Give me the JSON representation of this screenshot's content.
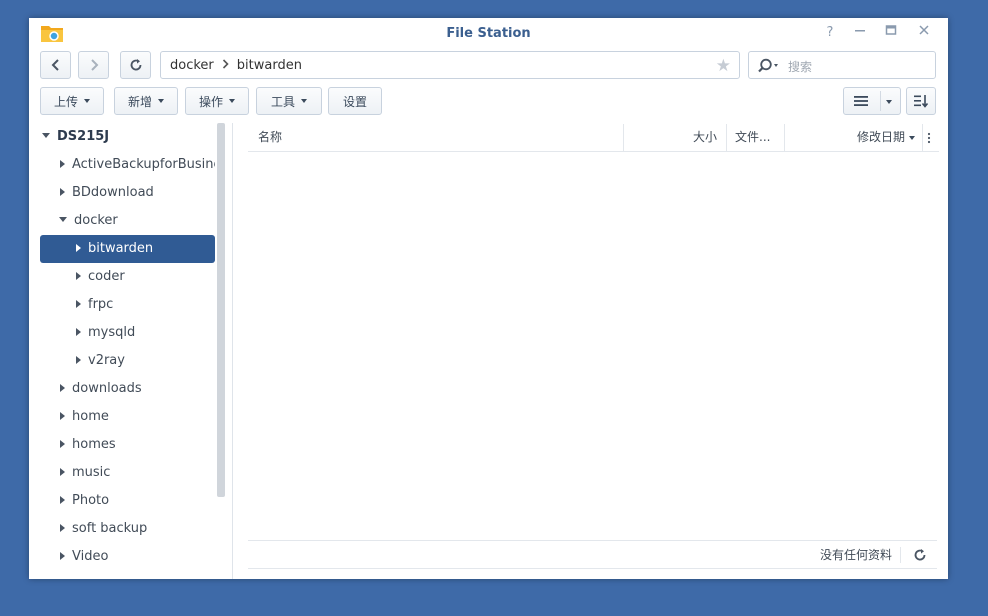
{
  "window": {
    "title": "File Station"
  },
  "path": {
    "segments": [
      "docker",
      "bitwarden"
    ]
  },
  "search": {
    "placeholder": "搜索"
  },
  "toolbar": {
    "upload_label": "上传",
    "create_label": "新增",
    "action_label": "操作",
    "tools_label": "工具",
    "settings_label": "设置"
  },
  "tree": {
    "root": "DS215J",
    "items": [
      {
        "label": "ActiveBackupforBusines",
        "level": 1,
        "expanded": false,
        "selected": false
      },
      {
        "label": "BDdownload",
        "level": 1,
        "expanded": false,
        "selected": false
      },
      {
        "label": "docker",
        "level": 1,
        "expanded": true,
        "selected": false
      },
      {
        "label": "bitwarden",
        "level": 2,
        "expanded": false,
        "selected": true
      },
      {
        "label": "coder",
        "level": 2,
        "expanded": false,
        "selected": false
      },
      {
        "label": "frpc",
        "level": 2,
        "expanded": false,
        "selected": false
      },
      {
        "label": "mysqld",
        "level": 2,
        "expanded": false,
        "selected": false
      },
      {
        "label": "v2ray",
        "level": 2,
        "expanded": false,
        "selected": false
      },
      {
        "label": "downloads",
        "level": 1,
        "expanded": false,
        "selected": false
      },
      {
        "label": "home",
        "level": 1,
        "expanded": false,
        "selected": false
      },
      {
        "label": "homes",
        "level": 1,
        "expanded": false,
        "selected": false
      },
      {
        "label": "music",
        "level": 1,
        "expanded": false,
        "selected": false
      },
      {
        "label": "Photo",
        "level": 1,
        "expanded": false,
        "selected": false
      },
      {
        "label": "soft backup",
        "level": 1,
        "expanded": false,
        "selected": false
      },
      {
        "label": "Video",
        "level": 1,
        "expanded": false,
        "selected": false
      }
    ]
  },
  "list": {
    "columns": {
      "name": "名称",
      "size": "大小",
      "type": "文件...",
      "modified": "修改日期"
    },
    "empty_text": "没有任何资料"
  },
  "colors": {
    "desktop": "#3e6aa8",
    "selected": "#305b94",
    "title": "#3b5f8f"
  }
}
